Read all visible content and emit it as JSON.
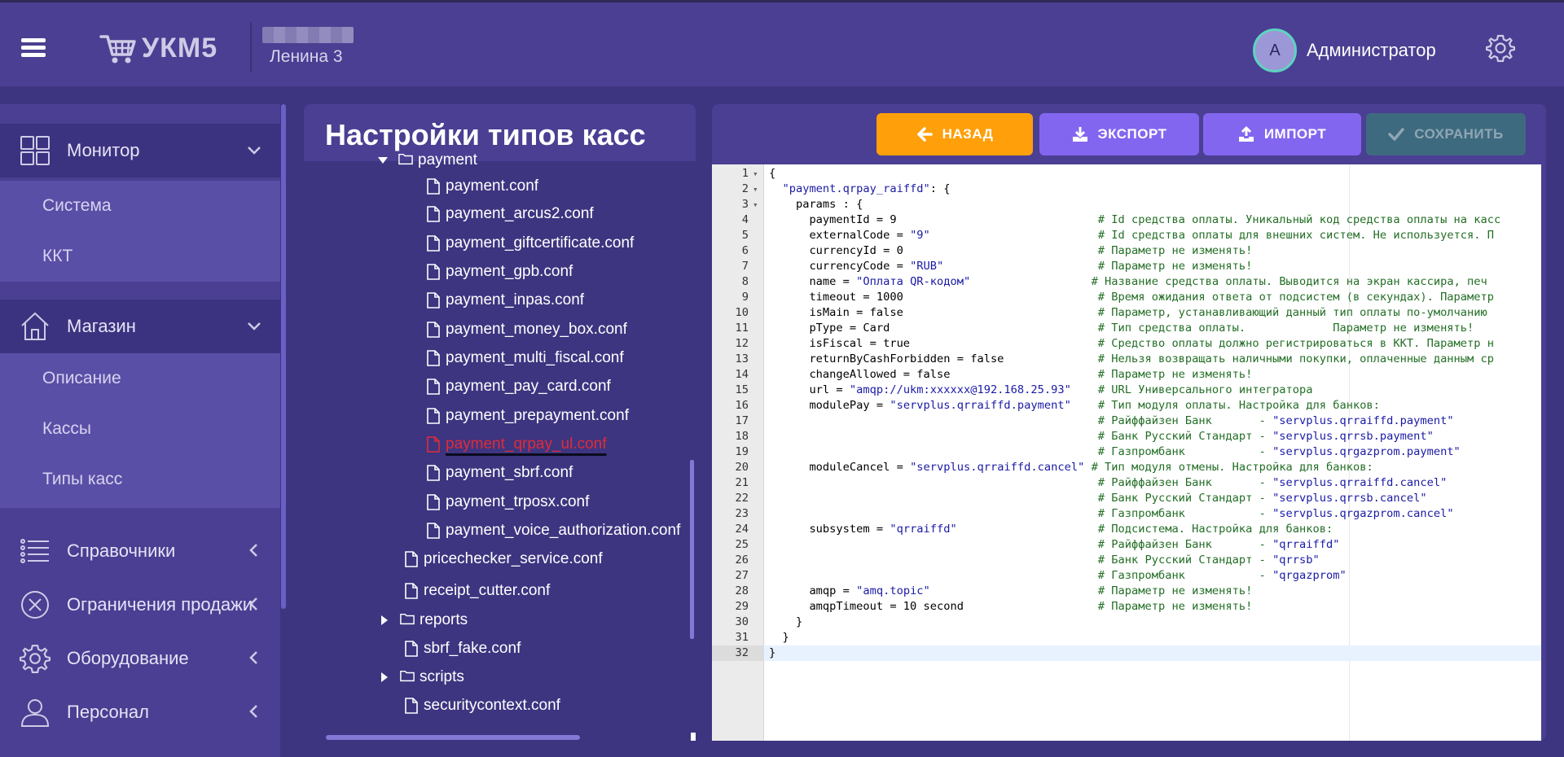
{
  "header": {
    "logo_text": "УКМ5",
    "store_name": "Ленина 3",
    "avatar_letter": "А",
    "user_name": "Администратор"
  },
  "sidebar": {
    "monitor": "Монитор",
    "monitor_sub": [
      "Система",
      "ККТ"
    ],
    "shop": "Магазин",
    "shop_sub": [
      "Описание",
      "Кассы",
      "Типы касс"
    ],
    "items": [
      "Справочники",
      "Ограничения продажи",
      "Оборудование",
      "Персонал"
    ]
  },
  "file_panel": {
    "title": "Настройки типов касс",
    "tree": [
      {
        "label": "payment",
        "type": "folder-open"
      },
      {
        "label": "payment.conf",
        "type": "file"
      },
      {
        "label": "payment_arcus2.conf",
        "type": "file"
      },
      {
        "label": "payment_giftcertificate.conf",
        "type": "file"
      },
      {
        "label": "payment_gpb.conf",
        "type": "file"
      },
      {
        "label": "payment_inpas.conf",
        "type": "file"
      },
      {
        "label": "payment_money_box.conf",
        "type": "file"
      },
      {
        "label": "payment_multi_fiscal.conf",
        "type": "file"
      },
      {
        "label": "payment_pay_card.conf",
        "type": "file"
      },
      {
        "label": "payment_prepayment.conf",
        "type": "file"
      },
      {
        "label": "payment_qrpay_ul.conf",
        "type": "file",
        "selected": true
      },
      {
        "label": "payment_sbrf.conf",
        "type": "file"
      },
      {
        "label": "payment_trposx.conf",
        "type": "file"
      },
      {
        "label": "payment_voice_authorization.conf",
        "type": "file"
      },
      {
        "label": "pricechecker_service.conf",
        "type": "file"
      },
      {
        "label": "receipt_cutter.conf",
        "type": "file"
      },
      {
        "label": "reports",
        "type": "folder-closed"
      },
      {
        "label": "sbrf_fake.conf",
        "type": "file"
      },
      {
        "label": "scripts",
        "type": "folder-closed"
      },
      {
        "label": "securitycontext.conf",
        "type": "file"
      }
    ]
  },
  "toolbar": {
    "back": "НАЗАД",
    "export": "ЭКСПОРТ",
    "import": "ИМПОРТ",
    "save": "СОХРАНИТЬ"
  },
  "editor": {
    "lines": [
      "{",
      "  \"payment.qrpay_raiffd\": {",
      "    params : {",
      "      paymentId = 9                              # Id средства оплаты. Уникальный код средства оплаты на касс",
      "      externalCode = \"9\"                         # Id средства оплаты для внешних систем. Не используется. П",
      "      currencyId = 0                             # Параметр не изменять!",
      "      currencyCode = \"RUB\"                       # Параметр не изменять!",
      "      name = \"Оплата QR-кодом\"                  # Название средства оплаты. Выводится на экран кассира, печ",
      "      timeout = 1000                             # Время ожидания ответа от подсистем (в секундах). Параметр",
      "      isMain = false                             # Параметр, устанавливающий данный тип оплаты по-умолчанию",
      "      pType = Card                               # Тип средства оплаты.             Параметр не изменять!",
      "      isFiscal = true                            # Средство оплаты должно регистрироваться в ККТ. Параметр н",
      "      returnByCashForbidden = false              # Нельзя возвращать наличными покупки, оплаченные данным ср",
      "      changeAllowed = false                      # Параметр не изменять!",
      "      url = \"amqp://ukm:xxxxxx@192.168.25.93\"    # URL Универсального интегратора",
      "      modulePay = \"servplus.qrraiffd.payment\"    # Тип модуля оплаты. Настройка для банков:",
      "                                                 # Райффайзен Банк       - \"servplus.qrraiffd.payment\"",
      "                                                 # Банк Русский Стандарт - \"servplus.qrrsb.payment\"",
      "                                                 # Газпромбанк           - \"servplus.qrgazprom.payment\"",
      "      moduleCancel = \"servplus.qrraiffd.cancel\" # Тип модуля отмены. Настройка для банков:",
      "                                                 # Райффайзен Банк       - \"servplus.qrraiffd.cancel\"",
      "                                                 # Банк Русский Стандарт - \"servplus.qrrsb.cancel\"",
      "                                                 # Газпромбанк           - \"servplus.qrgazprom.cancel\"",
      "      subsystem = \"qrraiffd\"                     # Подсистема. Настройка для банков:",
      "                                                 # Райффайзен Банк       - \"qrraiffd\"",
      "                                                 # Банк Русский Стандарт - \"qrrsb\"",
      "                                                 # Газпромбанк           - \"qrgazprom\"",
      "      amqp = \"amq.topic\"                         # Параметр не изменять!",
      "      amqpTimeout = 10 second                    # Параметр не изменять!",
      "    }",
      "  }",
      "}"
    ]
  },
  "colors": {
    "header_bg": "#4a3f92",
    "page_bg": "#3d3580",
    "back_btn": "#ff9f0a",
    "action_btn": "#8366f0",
    "save_btn_disabled": "#3e6a80",
    "selected_file": "#e02b38"
  }
}
